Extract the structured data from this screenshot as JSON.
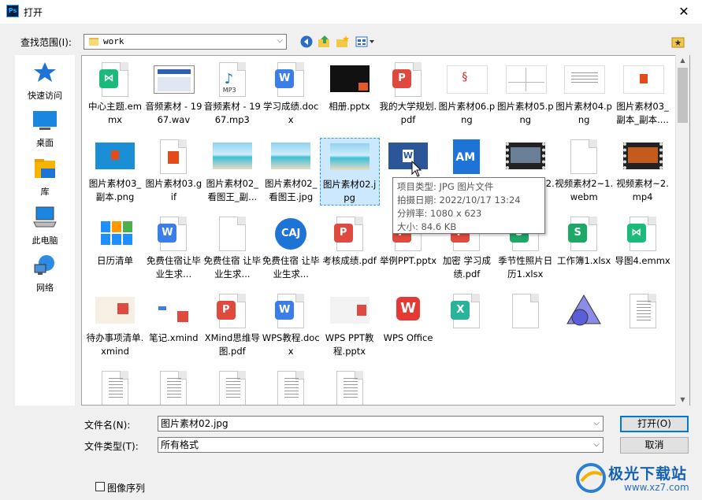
{
  "window": {
    "title": "打开",
    "app_icon_text": "Ps"
  },
  "lookin": {
    "label": "查找范围(I):",
    "value": "work"
  },
  "places": [
    {
      "label": "快速访问",
      "icon": "star-icon"
    },
    {
      "label": "桌面",
      "icon": "desktop-icon"
    },
    {
      "label": "库",
      "icon": "library-icon"
    },
    {
      "label": "此电脑",
      "icon": "computer-icon"
    },
    {
      "label": "网络",
      "icon": "network-icon"
    }
  ],
  "files": [
    {
      "name": "中心主题.emmx",
      "type": "emmx"
    },
    {
      "name": "音频素材 - 1967.wav",
      "type": "wav"
    },
    {
      "name": "音频素材 - 1967.mp3",
      "type": "mp3"
    },
    {
      "name": "学习成绩.docx",
      "type": "docx"
    },
    {
      "name": "相册.pptx",
      "type": "pptx-dark"
    },
    {
      "name": "我的大学规划.pdf",
      "type": "pdf"
    },
    {
      "name": "图片素材06.png",
      "type": "img-sketch"
    },
    {
      "name": "图片素材05.png",
      "type": "img-graph"
    },
    {
      "name": "图片素材04.png",
      "type": "img-text"
    },
    {
      "name": "图片素材03_副本_副本....",
      "type": "img-office"
    },
    {
      "name": "图片素材03_副本.png",
      "type": "img-office-blue"
    },
    {
      "name": "图片素材03.gif",
      "type": "gif-office"
    },
    {
      "name": "图片素材02_看图王_副...",
      "type": "img-beach"
    },
    {
      "name": "图片素材02_看图王.jpg",
      "type": "img-beach"
    },
    {
      "name": "图片素材02.jpg",
      "type": "img-beach"
    },
    {
      "name": "",
      "type": "word-app"
    },
    {
      "name": "",
      "type": "am"
    },
    {
      "name": "视频素材2~2.mp4",
      "type": "video"
    },
    {
      "name": "视频素材2~1.webm",
      "type": "blank"
    },
    {
      "name": "视频素材~2.mp4",
      "type": "video-orange"
    },
    {
      "name": "日历清单",
      "type": "calendar"
    },
    {
      "name": "免费住宿让毕业生求...",
      "type": "docx"
    },
    {
      "name": "免费住宿 让毕业生求...",
      "type": "blank"
    },
    {
      "name": "免费住宿 让毕业生求...",
      "type": "caj"
    },
    {
      "name": "考核成绩.pdf",
      "type": "pdf"
    },
    {
      "name": "举例PPT.pptx",
      "type": "pdf"
    },
    {
      "name": "加密 学习成绩.pdf",
      "type": "pdf"
    },
    {
      "name": "季节性照片日历1.xlsx",
      "type": "xlsx"
    },
    {
      "name": "工作簿1.xlsx",
      "type": "xlsx"
    },
    {
      "name": "导图4.emmx",
      "type": "emmx"
    },
    {
      "name": "待办事项清单.xmind",
      "type": "xmind-todo"
    },
    {
      "name": "笔记.xmind",
      "type": "xmind"
    },
    {
      "name": "XMind思维导图.pdf",
      "type": "pdf"
    },
    {
      "name": "WPS教程.docx",
      "type": "docx"
    },
    {
      "name": "WPS PPT教程.pptx",
      "type": "wpsppt"
    },
    {
      "name": "WPS Office",
      "type": "wps-office"
    },
    {
      "name": "",
      "type": "xlsx-green"
    },
    {
      "name": "",
      "type": "blank"
    },
    {
      "name": "",
      "type": "shapes"
    },
    {
      "name": "",
      "type": "lines"
    },
    {
      "name": "",
      "type": "lines"
    },
    {
      "name": "",
      "type": "lines"
    },
    {
      "name": "",
      "type": "lines"
    },
    {
      "name": "",
      "type": "lines"
    },
    {
      "name": "",
      "type": "lines"
    }
  ],
  "tooltip": {
    "line1": "项目类型: JPG 图片文件",
    "line2": "拍摄日期: 2022/10/17 13:24",
    "line3": "分辨率: 1080 x 623",
    "line4": "大小: 84.6 KB"
  },
  "filename": {
    "label": "文件名(N):",
    "value": "图片素材02.jpg"
  },
  "filetype": {
    "label": "文件类型(T):",
    "value": "所有格式"
  },
  "buttons": {
    "open": "打开(O)",
    "cancel": "取消"
  },
  "image_sequence": {
    "label": "图像序列",
    "checked": false
  },
  "watermark": {
    "text": "极光下载站",
    "url": "www.xz7.com"
  },
  "colors": {
    "pdf": "#e04a3e",
    "docx": "#3b7de9",
    "xlsx": "#1ea866",
    "emmx": "#1bb97a",
    "selection": "#cce8ff"
  }
}
